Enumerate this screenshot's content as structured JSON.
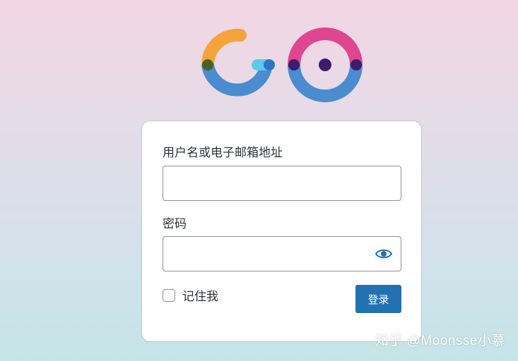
{
  "logo": {
    "text": "GO"
  },
  "form": {
    "username_label": "用户名或电子邮箱地址",
    "username_value": "",
    "password_label": "密码",
    "password_value": "",
    "show_password_icon": "eye-icon",
    "remember_label": "记住我",
    "remember_checked": false,
    "submit_label": "登录"
  },
  "watermark": "知乎 @Moonsse小慕",
  "colors": {
    "primary": "#2271b1",
    "logo_orange": "#f5a43a",
    "logo_blue": "#4a8ccf",
    "logo_pink": "#e0458f",
    "logo_cyan": "#5bc8ee",
    "logo_dot": "#3b1d6b"
  }
}
